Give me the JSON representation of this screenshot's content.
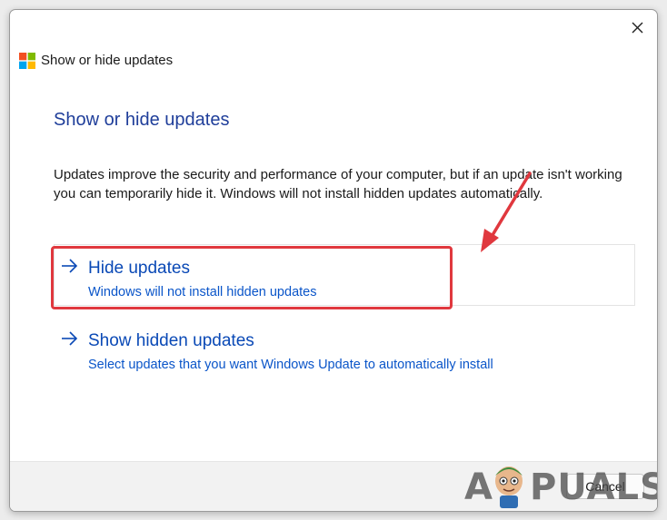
{
  "window": {
    "title": "Show or hide updates",
    "close_icon": "close-icon",
    "logo_icon": "windows-logo-icon"
  },
  "main": {
    "heading": "Show or hide updates",
    "description": "Updates improve the security and performance of your computer, but if an update isn't working you can temporarily hide it. Windows will not install hidden updates automatically.",
    "options": [
      {
        "title": "Hide updates",
        "subtitle": "Windows will not install hidden updates",
        "icon": "arrow-right-icon",
        "highlighted": true
      },
      {
        "title": "Show hidden updates",
        "subtitle": "Select updates that you want Windows Update to automatically install",
        "icon": "arrow-right-icon",
        "highlighted": false
      }
    ]
  },
  "footer": {
    "cancel_label": "Cancel"
  },
  "watermark": {
    "text_left": "A",
    "text_right": "PUALS"
  },
  "colors": {
    "heading": "#1f3e9a",
    "link": "#0a49b6",
    "highlight": "#e0383e"
  }
}
